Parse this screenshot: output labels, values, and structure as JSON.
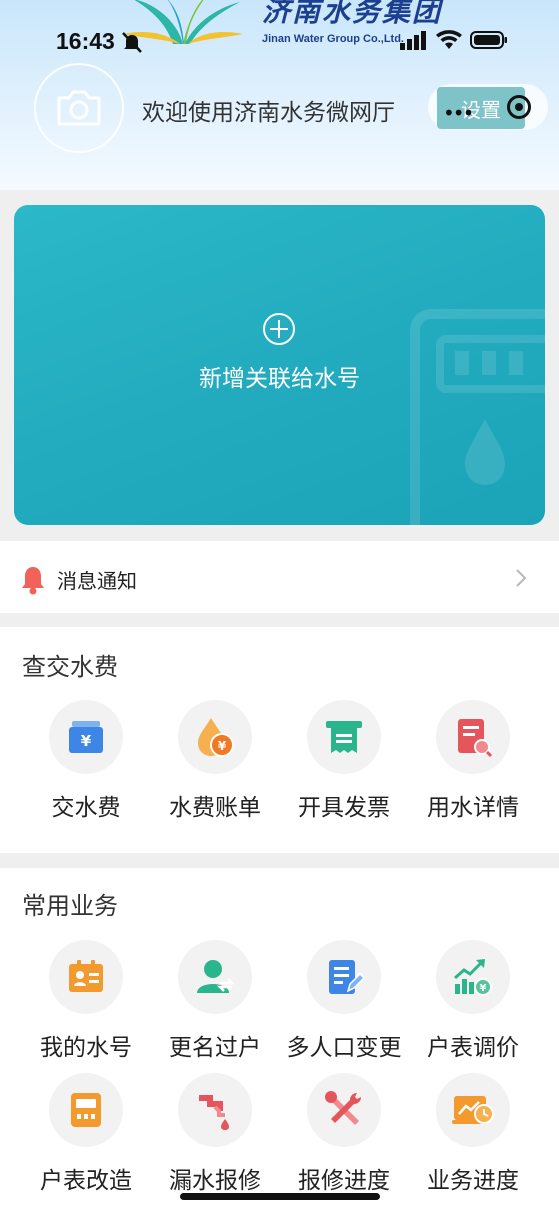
{
  "status_bar": {
    "time": "16:43"
  },
  "header": {
    "logo_cn": "济南水务集团",
    "logo_en": "Jinan Water Group Co.,Ltd.",
    "welcome": "欢迎使用济南水务微网厅",
    "settings_label": "设置"
  },
  "card": {
    "add_label": "新增关联给水号"
  },
  "notice": {
    "label": "消息通知"
  },
  "section_fees": {
    "title": "查交水费",
    "items": [
      {
        "label": "交水费",
        "icon": "yuan-card-icon",
        "color": "#3d86e6"
      },
      {
        "label": "水费账单",
        "icon": "water-drop-yuan-icon",
        "color": "#f29a2e"
      },
      {
        "label": "开具发票",
        "icon": "invoice-icon",
        "color": "#2bb58c"
      },
      {
        "label": "用水详情",
        "icon": "document-search-icon",
        "color": "#e5555c"
      }
    ]
  },
  "section_business": {
    "title": "常用业务",
    "items": [
      {
        "label": "我的水号",
        "icon": "id-card-icon",
        "color": "#f29a2e"
      },
      {
        "label": "更名过户",
        "icon": "user-transfer-icon",
        "color": "#2bb58c"
      },
      {
        "label": "多人口变更",
        "icon": "document-edit-icon",
        "color": "#3d86e6"
      },
      {
        "label": "户表调价",
        "icon": "price-chart-icon",
        "color": "#2bb58c"
      },
      {
        "label": "户表改造",
        "icon": "meter-icon",
        "color": "#f29a2e"
      },
      {
        "label": "漏水报修",
        "icon": "leaking-pipe-icon",
        "color": "#e5555c"
      },
      {
        "label": "报修进度",
        "icon": "tools-icon",
        "color": "#e5555c"
      },
      {
        "label": "业务进度",
        "icon": "progress-clock-icon",
        "color": "#f29a2e"
      }
    ]
  }
}
